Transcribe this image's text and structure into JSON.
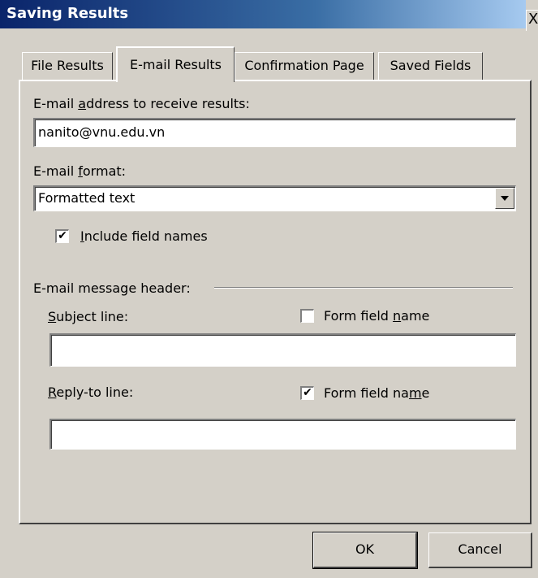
{
  "window": {
    "title": "Saving Results",
    "close_glyph": "X"
  },
  "tabs": [
    {
      "label": "File Results"
    },
    {
      "label": "E-mail Results"
    },
    {
      "label": "Confirmation Page"
    },
    {
      "label": "Saved Fields"
    }
  ],
  "active_tab": "E-mail Results",
  "email_address": {
    "label_pre": "E-mail ",
    "label_accel": "a",
    "label_post": "ddress to receive results:",
    "value": "nanito@vnu.edu.vn"
  },
  "email_format": {
    "label_pre": "E-mail ",
    "label_accel": "f",
    "label_post": "ormat:",
    "value": "Formatted text"
  },
  "include_field_names": {
    "label_accel": "I",
    "label_post": "nclude field names",
    "checked": true,
    "mark": "✔"
  },
  "message_header": {
    "label": "E-mail message header:"
  },
  "subject_line": {
    "label_accel": "S",
    "label_post": "ubject line:",
    "value": "",
    "form_field": {
      "label_pre": "Form field ",
      "label_accel": "n",
      "label_post": "ame",
      "checked": false
    }
  },
  "reply_to_line": {
    "label_accel": "R",
    "label_post": "eply-to line:",
    "value": "",
    "form_field": {
      "label_pre": "Form field na",
      "label_accel": "m",
      "label_post": "e",
      "checked": true,
      "mark": "✔"
    }
  },
  "buttons": {
    "ok": "OK",
    "cancel": "Cancel"
  }
}
